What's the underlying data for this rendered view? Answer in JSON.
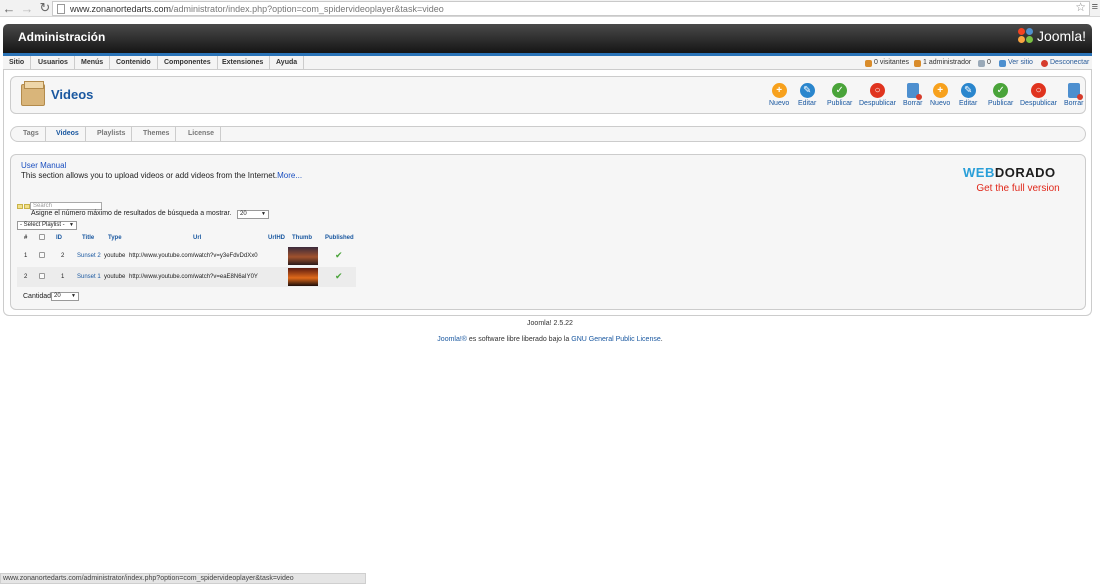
{
  "browser": {
    "url_host": "www.zonanortedarts.com",
    "url_path": "/administrator/index.php?option=com_spidervideoplayer&task=video"
  },
  "header": {
    "title": "Administración",
    "logo_text": "Joomla!"
  },
  "menu": {
    "items": [
      "Sitio",
      "Usuarios",
      "Menús",
      "Contenido",
      "Componentes",
      "Extensiones",
      "Ayuda"
    ],
    "status": {
      "visitors": "0 visitantes",
      "admins": "1 administrador",
      "messages": "0",
      "view_site": "Ver sitio",
      "logout": "Desconectar"
    }
  },
  "toolbar": {
    "page_title": "Videos",
    "buttons": [
      "Nuevo",
      "Editar",
      "Publicar",
      "Despublicar",
      "Borrar",
      "Nuevo",
      "Editar",
      "Publicar",
      "Despublicar",
      "Borrar"
    ]
  },
  "submenu": {
    "items": [
      "Tags",
      "Videos",
      "Playlists",
      "Themes",
      "License"
    ],
    "active": "Videos"
  },
  "main": {
    "manual_link": "User Manual",
    "intro_text": "This section allows you to upload videos or add videos from the Internet.",
    "more_link": "More...",
    "promo_brand_web": "WEB",
    "promo_brand_rest": "DORADO",
    "promo_cta": "Get the full version",
    "search_placeholder": "Search",
    "limit_label": "Asigne el número máximo de resultados de búsqueda a mostrar.",
    "limit_value": "20",
    "playlist_select": "- Select Playlist -",
    "table": {
      "headers": [
        "#",
        "ID",
        "Title",
        "Type",
        "Url",
        "UrlHD",
        "Thumb",
        "Published"
      ],
      "rows": [
        {
          "num": "1",
          "id": "2",
          "title": "Sunset 2",
          "type": "youtube",
          "url": "http://www.youtube.com/watch?v=y3eFdvDdXx0",
          "published": true
        },
        {
          "num": "2",
          "id": "1",
          "title": "Sunset 1",
          "type": "youtube",
          "url": "http://www.youtube.com/watch?v=eaE8N6aIY0Y",
          "published": true
        }
      ]
    },
    "quantity_label": "Cantidad",
    "quantity_value": "20"
  },
  "footer": {
    "version": "Joomla! 2.5.22",
    "license_prefix": "Joomla!®",
    "license_mid": " es software libre liberado bajo la ",
    "license_link": "GNU General Public License",
    "license_end": "."
  },
  "status_bar_url": "www.zonanortedarts.com/administrator/index.php?option=com_spidervideoplayer&task=video"
}
